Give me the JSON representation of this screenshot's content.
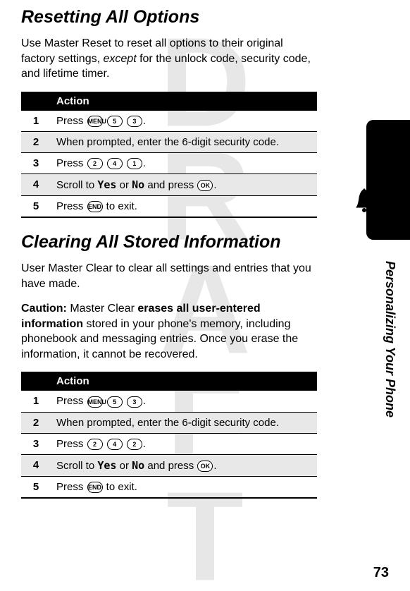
{
  "watermark": "DRAFT",
  "section1": {
    "title": "Resetting All Options",
    "intro_a": "Use Master Reset to reset all options to their original factory settings, ",
    "intro_except": "except",
    "intro_b": " for the unlock code, security code, and lifetime timer."
  },
  "table1": {
    "header": "Action",
    "rows": [
      {
        "n": "1",
        "preText": "Press ",
        "keys": [
          "MENU",
          "5",
          "3"
        ],
        "postText": "."
      },
      {
        "n": "2",
        "preText": "When prompted, enter the 6-digit security code.",
        "keys": [],
        "postText": ""
      },
      {
        "n": "3",
        "preText": "Press ",
        "keys": [
          "2",
          "4",
          "1"
        ],
        "postText": "."
      },
      {
        "n": "4",
        "preText": "Scroll to ",
        "ui1": "Yes",
        "mid": " or ",
        "ui2": "No",
        "after": " and press ",
        "keys": [
          "OK"
        ],
        "postText": "."
      },
      {
        "n": "5",
        "preText": "Press ",
        "keys": [
          "END"
        ],
        "postText": " to exit."
      }
    ]
  },
  "section2": {
    "title": "Clearing All Stored Information",
    "intro": "User Master Clear to clear all settings and entries that you have made.",
    "caution_label": "Caution:",
    "caution_a": " Master Clear ",
    "caution_bold": "erases all user-entered information",
    "caution_b": " stored in your phone's memory, including phonebook and messaging entries. Once you erase the information, it cannot be recovered."
  },
  "table2": {
    "header": "Action",
    "rows": [
      {
        "n": "1",
        "preText": "Press ",
        "keys": [
          "MENU",
          "5",
          "3"
        ],
        "postText": "."
      },
      {
        "n": "2",
        "preText": "When prompted, enter the 6-digit security code.",
        "keys": [],
        "postText": ""
      },
      {
        "n": "3",
        "preText": "Press ",
        "keys": [
          "2",
          "4",
          "2"
        ],
        "postText": "."
      },
      {
        "n": "4",
        "preText": "Scroll to ",
        "ui1": "Yes",
        "mid": " or ",
        "ui2": "No",
        "after": " and press ",
        "keys": [
          "OK"
        ],
        "postText": "."
      },
      {
        "n": "5",
        "preText": "Press ",
        "keys": [
          "END"
        ],
        "postText": " to exit."
      }
    ]
  },
  "side_label": "Personalizing Your Phone",
  "page_number": "73"
}
